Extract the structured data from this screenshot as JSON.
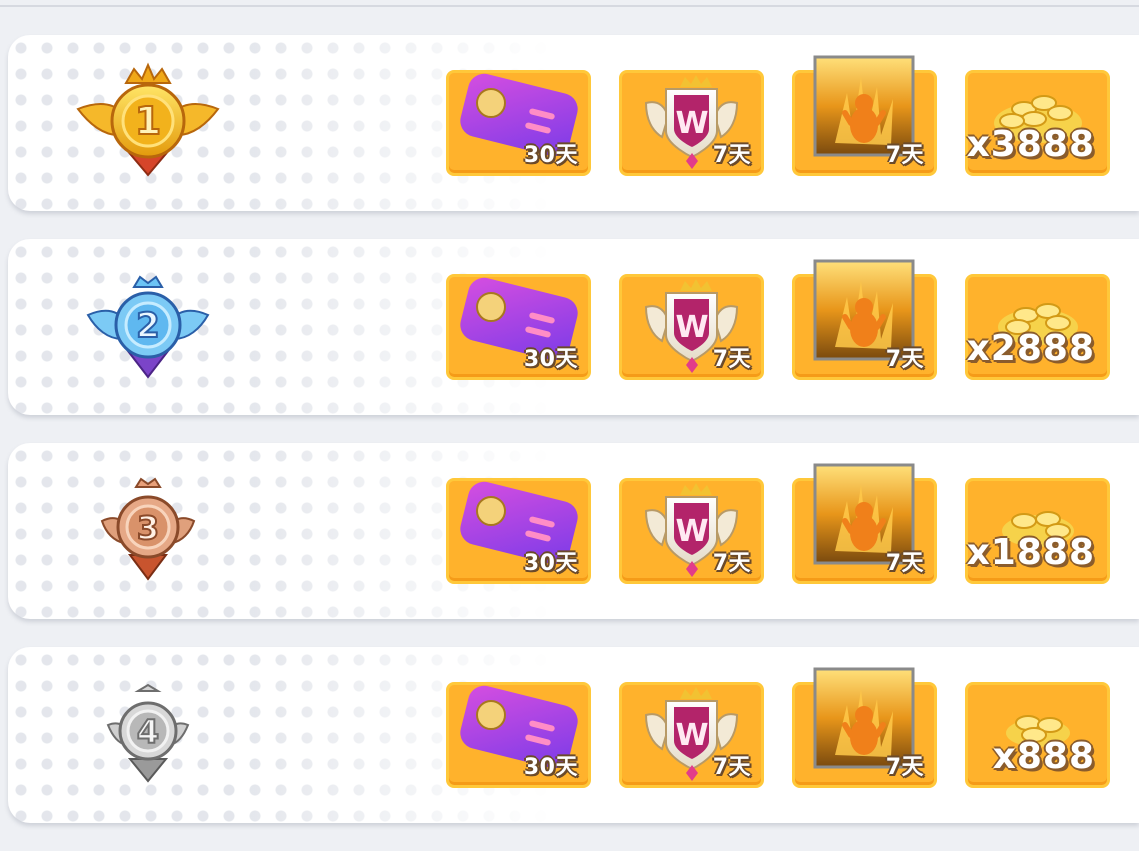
{
  "rows": [
    {
      "rank": "1",
      "badge_color": "#f2b21c",
      "badge_icon": "gold-rank-medal",
      "card_days": "30天",
      "emblem_days": "7天",
      "effect_days": "7天",
      "coins": "x3888"
    },
    {
      "rank": "2",
      "badge_color": "#5fb8f0",
      "badge_icon": "silver-blue-rank-medal",
      "card_days": "30天",
      "emblem_days": "7天",
      "effect_days": "7天",
      "coins": "x2888"
    },
    {
      "rank": "3",
      "badge_color": "#d9926a",
      "badge_icon": "bronze-rank-medal",
      "card_days": "30天",
      "emblem_days": "7天",
      "effect_days": "7天",
      "coins": "x1888"
    },
    {
      "rank": "4",
      "badge_color": "#b8b8b8",
      "badge_icon": "gray-rank-medal",
      "card_days": "30天",
      "emblem_days": "7天",
      "effect_days": "7天",
      "coins": "x888"
    }
  ],
  "colors": {
    "reward_bg": "#ffb22c",
    "row_bg": "#ffffff",
    "page_bg": "#eef0f4"
  }
}
